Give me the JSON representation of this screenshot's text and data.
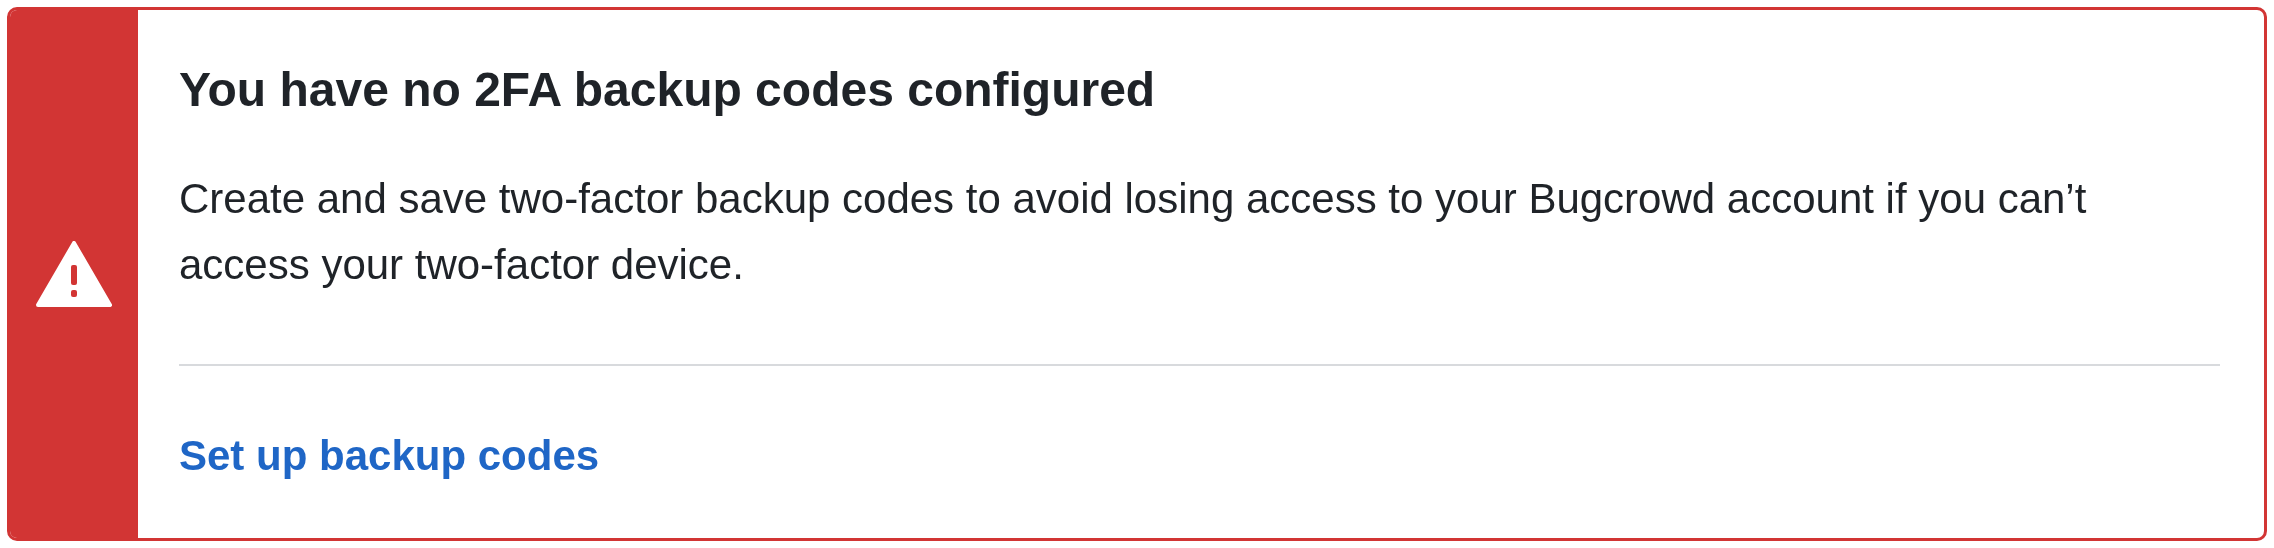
{
  "alert": {
    "color": "#d23534",
    "title": "You have no 2FA backup codes configured",
    "message": "Create and save two-factor backup codes to avoid losing access to your Bugcrowd account if you can’t access your two-factor device.",
    "action_link": "Set up backup codes"
  }
}
